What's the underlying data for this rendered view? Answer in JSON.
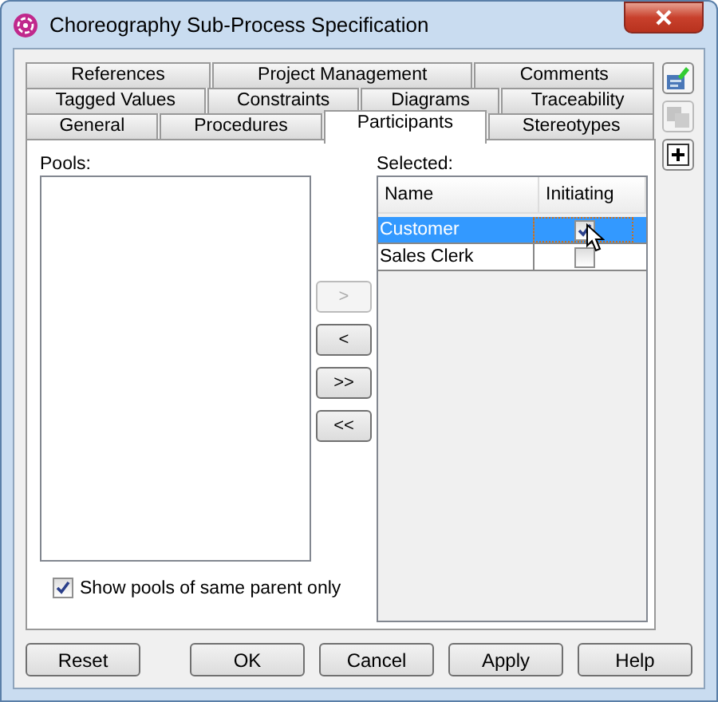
{
  "window": {
    "title": "Choreography Sub-Process Specification"
  },
  "tab_rows": [
    [
      {
        "label": "References",
        "selected": false
      },
      {
        "label": "Project Management",
        "selected": false
      },
      {
        "label": "Comments",
        "selected": false
      }
    ],
    [
      {
        "label": "Tagged Values",
        "selected": false
      },
      {
        "label": "Constraints",
        "selected": false
      },
      {
        "label": "Diagrams",
        "selected": false
      },
      {
        "label": "Traceability",
        "selected": false
      }
    ],
    [
      {
        "label": "General",
        "selected": false
      },
      {
        "label": "Procedures",
        "selected": false
      },
      {
        "label": "Participants",
        "selected": true
      },
      {
        "label": "Stereotypes",
        "selected": false
      }
    ]
  ],
  "side_toolbar": [
    {
      "kind": "edit",
      "disabled": false
    },
    {
      "kind": "copy",
      "disabled": true
    },
    {
      "kind": "add",
      "disabled": false
    }
  ],
  "pools": {
    "label": "Pools:"
  },
  "show_same_parent": {
    "label": "Show pools of same parent only",
    "checked": true
  },
  "transfer_buttons": [
    {
      "label": ">",
      "disabled": true
    },
    {
      "label": "<",
      "disabled": false
    },
    {
      "label": ">>",
      "disabled": false
    },
    {
      "label": "<<",
      "disabled": false
    }
  ],
  "selected": {
    "label": "Selected:",
    "columns": [
      "Name",
      "Initiating"
    ],
    "rows": [
      {
        "name": "Customer",
        "initiating": true,
        "selected": true
      },
      {
        "name": "Sales Clerk",
        "initiating": false,
        "selected": false
      }
    ]
  },
  "buttons": [
    "Reset",
    "OK",
    "Cancel",
    "Apply",
    "Help"
  ]
}
